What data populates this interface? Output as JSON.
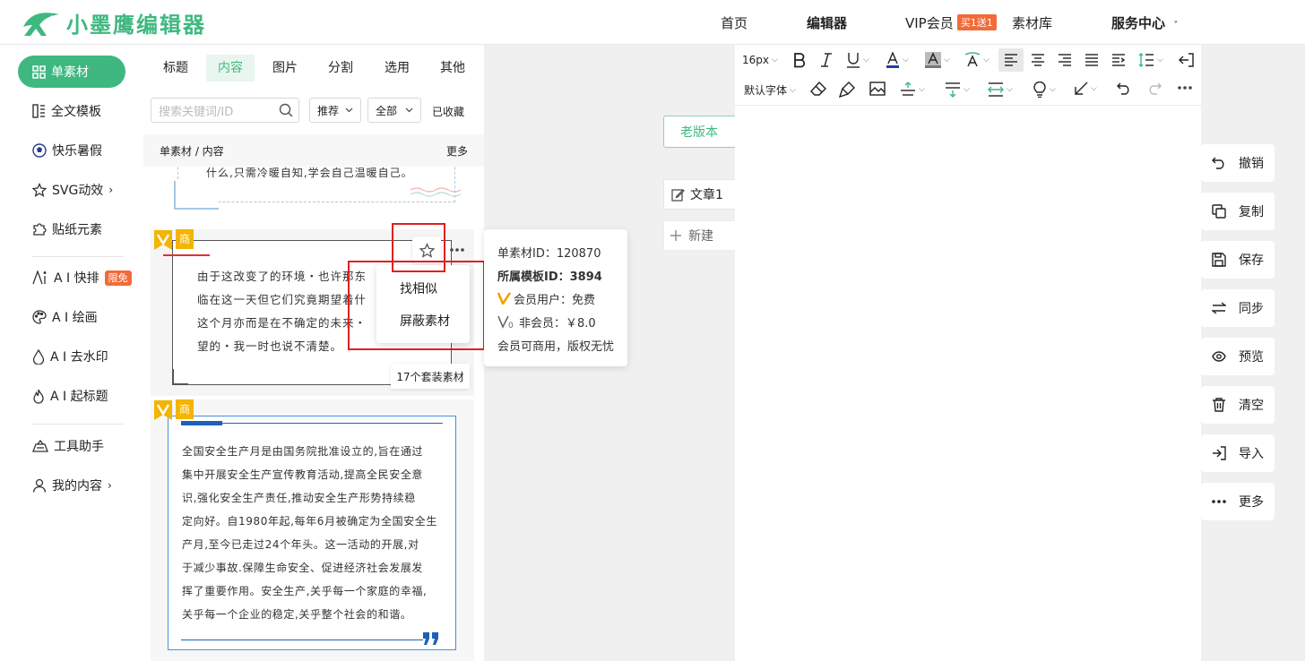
{
  "header": {
    "logo_text": "小墨鹰编辑器",
    "nav": [
      {
        "label": "首页"
      },
      {
        "label": "编辑器"
      },
      {
        "label": "VIP会员"
      },
      {
        "label": "素材库"
      },
      {
        "label": "服务中心"
      }
    ],
    "vip_badge": "买1送1",
    "service_chevron": "˅"
  },
  "left_nav": {
    "items": [
      {
        "label": "单素材",
        "icon": "grid-icon"
      },
      {
        "label": "全文模板",
        "icon": "template-icon"
      },
      {
        "label": "快乐暑假",
        "icon": "ball-icon"
      },
      {
        "label": "SVG动效",
        "icon": "star-outline-icon"
      },
      {
        "label": "贴纸元素",
        "icon": "puzzle-icon"
      },
      {
        "label": "A I 快排",
        "icon": "ai-icon"
      },
      {
        "label": "A I 绘画",
        "icon": "palette-icon"
      },
      {
        "label": "A I 去水印",
        "icon": "drop-icon"
      },
      {
        "label": "A I 起标题",
        "icon": "flame-icon"
      },
      {
        "label": "工具助手",
        "icon": "toolbox-icon"
      },
      {
        "label": "我的内容",
        "icon": "user-icon"
      }
    ],
    "limit_badge": "限免",
    "chevron": "›"
  },
  "material_panel": {
    "tabs": [
      "标题",
      "内容",
      "图片",
      "分割",
      "选用",
      "其他"
    ],
    "search_placeholder": "搜索关键词/ID",
    "sort_dropdown": "推荐",
    "filter_dropdown": "全部",
    "favorites_link": "已收藏",
    "breadcrumb": "单素材 / 内容",
    "more_link": "更多",
    "cards": [
      {
        "text": "什么,只需冷暖自知,学会自己温暖自己。"
      },
      {
        "lines": [
          "由于这改变了的环境・也许那东",
          "临在这一天但它们究竟期望着什",
          "这个月亦而是在不确定的未来・",
          "望的・我一时也说不清楚。"
        ],
        "set_badge": "17个套装素材",
        "tag": "商"
      },
      {
        "lines": [
          "全国安全生产月是由国务院批准设立的,旨在通过",
          "集中开展安全生产宣传教育活动,提高全民安全意",
          "识,强化安全生产责任,推动安全生产形势持续稳",
          "定向好。自1980年起,每年6月被确定为全国安全生",
          "产月,至今已走过24个年头。这一活动的开展,对",
          "于减少事故.保障生命安全、促进经济社会发展发",
          "挥了重要作用。安全生产,关乎每一个家庭的幸福,",
          "关乎每一个企业的稳定,关乎整个社会的和谐。"
        ],
        "tag": "商"
      }
    ]
  },
  "context_menu": {
    "items": [
      "找相似",
      "屏蔽素材"
    ]
  },
  "info_popup": {
    "material_id": "单素材ID：120870",
    "template_id": "所属模板ID：3894",
    "member_price": "会员用户：免费",
    "nonmember_price": "非会员：￥8.0",
    "license": "会员可商用，版权无忧"
  },
  "workspace": {
    "old_version_button": "老版本",
    "doc_tab": "文章1",
    "new_doc_button": "新建"
  },
  "editor_toolbar": {
    "font_size": "16px",
    "font_family": "默认字体",
    "colors": {
      "font_color": "#1e3fa8",
      "accent": "#3fb880"
    }
  },
  "side_actions": [
    {
      "label": "撤销",
      "icon": "undo-icon"
    },
    {
      "label": "复制",
      "icon": "copy-icon"
    },
    {
      "label": "保存",
      "icon": "save-icon"
    },
    {
      "label": "同步",
      "icon": "sync-icon"
    },
    {
      "label": "预览",
      "icon": "eye-icon"
    },
    {
      "label": "清空",
      "icon": "trash-icon"
    },
    {
      "label": "导入",
      "icon": "import-icon"
    },
    {
      "label": "更多",
      "icon": "more-icon"
    }
  ]
}
